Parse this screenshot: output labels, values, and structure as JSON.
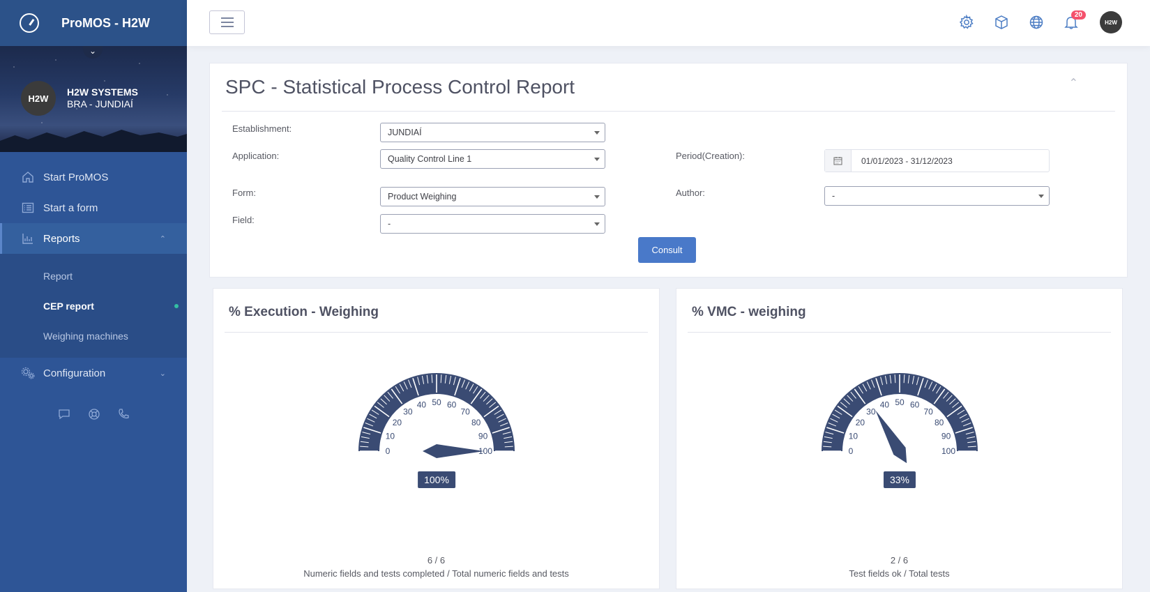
{
  "app": {
    "title": "ProMOS - H2W"
  },
  "profile": {
    "avatar_text": "H2W",
    "company": "H2W SYSTEMS",
    "location": "BRA - JUNDIAÍ"
  },
  "sidebar": {
    "items": [
      {
        "label": "Start ProMOS",
        "icon": "home-icon"
      },
      {
        "label": "Start a form",
        "icon": "list-icon"
      },
      {
        "label": "Reports",
        "icon": "bar-chart-icon",
        "active": true,
        "expanded": true
      },
      {
        "label": "Configuration",
        "icon": "gears-icon"
      }
    ],
    "sub_items": [
      {
        "label": "Report"
      },
      {
        "label": "CEP report",
        "current": true
      },
      {
        "label": "Weighing machines"
      }
    ],
    "quick_icons": [
      "chat-icon",
      "lifebuoy-icon",
      "phone-icon"
    ]
  },
  "topbar": {
    "notification_count": "20",
    "avatar_text": "H2W"
  },
  "filters": {
    "title": "SPC - Statistical Process Control Report",
    "establishment_label": "Establishment:",
    "establishment_value": "JUNDIAÍ",
    "application_label": "Application:",
    "application_value": "Quality Control Line 1",
    "period_label": "Period(Creation):",
    "period_value": "01/01/2023 - 31/12/2023",
    "form_label": "Form:",
    "form_value": "Product Weighing",
    "author_label": "Author:",
    "author_value": "-",
    "field_label": "Field:",
    "field_value": "-",
    "consult_label": "Consult"
  },
  "gauges": [
    {
      "title": "% Execution - Weighing",
      "value": 100,
      "value_label": "100%",
      "ratio": "6 / 6",
      "caption": "Numeric fields and tests completed / Total numeric fields and tests"
    },
    {
      "title": "% VMC - weighing",
      "value": 33,
      "value_label": "33%",
      "ratio": "2 / 6",
      "caption": "Test fields ok / Total tests"
    }
  ],
  "gauge_scale": {
    "min": 0,
    "max": 100,
    "ticks": [
      "0",
      "10",
      "20",
      "30",
      "40",
      "50",
      "60",
      "70",
      "80",
      "90",
      "100"
    ]
  },
  "colors": {
    "sidebar": "#2e5596",
    "accent": "#4979c9",
    "gauge": "#3a4b73",
    "badge": "#f4516c"
  }
}
